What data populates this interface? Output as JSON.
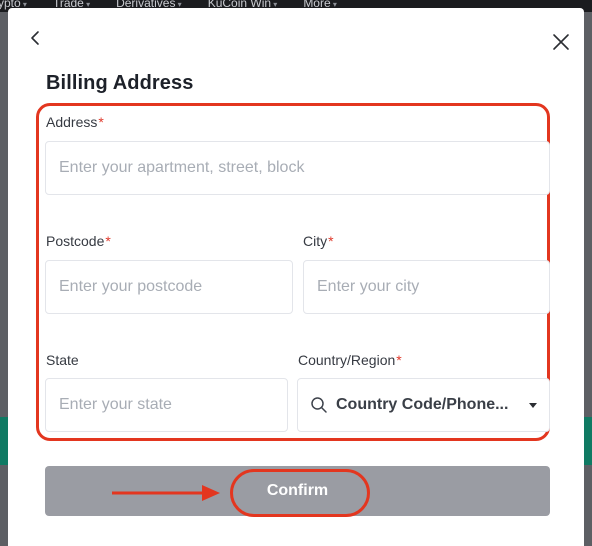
{
  "background_nav": {
    "items": [
      "ypto",
      "Trade",
      "Derivatives",
      "KuCoin Win",
      "More"
    ]
  },
  "modal": {
    "title": "Billing Address",
    "fields": {
      "address": {
        "label": "Address",
        "required_mark": "*",
        "placeholder": "Enter your apartment, street, block"
      },
      "postcode": {
        "label": "Postcode",
        "required_mark": "*",
        "placeholder": "Enter your postcode"
      },
      "city": {
        "label": "City",
        "required_mark": "*",
        "placeholder": "Enter your city"
      },
      "state": {
        "label": "State",
        "placeholder": "Enter your state"
      },
      "country": {
        "label": "Country/Region",
        "required_mark": "*",
        "selected": "Country  Code/Phone..."
      }
    },
    "confirm_label": "Confirm"
  },
  "icons": {
    "back": "chevron-left-icon",
    "close": "close-icon",
    "search": "search-icon",
    "caret": "caret-down-icon",
    "arrow": "arrow-right-icon"
  },
  "colors": {
    "highlight": "#e3361f",
    "required": "#e0392b",
    "button_disabled": "#9a9ca3",
    "title": "#1d2129"
  }
}
